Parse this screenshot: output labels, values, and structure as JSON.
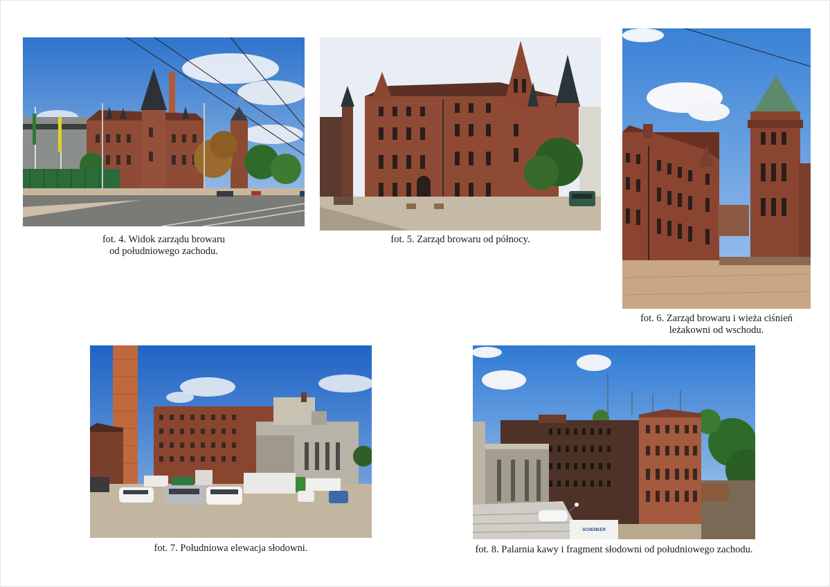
{
  "photos": [
    {
      "id": "fot-4",
      "caption_line1": "fot. 4. Widok zarządu browaru",
      "caption_line2": "od południowego zachodu."
    },
    {
      "id": "fot-5",
      "caption_line1": "fot. 5. Zarząd browaru od północy."
    },
    {
      "id": "fot-6",
      "caption_line1": "fot. 6. Zarząd browaru i wieża ciśnień",
      "caption_line2": "leżakowni od wschodu."
    },
    {
      "id": "fot-7",
      "caption_line1": "fot. 7. Południowa elewacja słodowni."
    },
    {
      "id": "fot-8",
      "caption_line1": "fot. 8. Palarnia kawy i fragment słodowni od południowego zachodu.",
      "truck_sign": "SCHENKER"
    }
  ],
  "colors": {
    "sky": "#4f8fd6",
    "brick": "#8c4632",
    "roof": "#3c4a52",
    "pavement": "#c9b9a2",
    "caption_text": "#1a1a1a"
  }
}
